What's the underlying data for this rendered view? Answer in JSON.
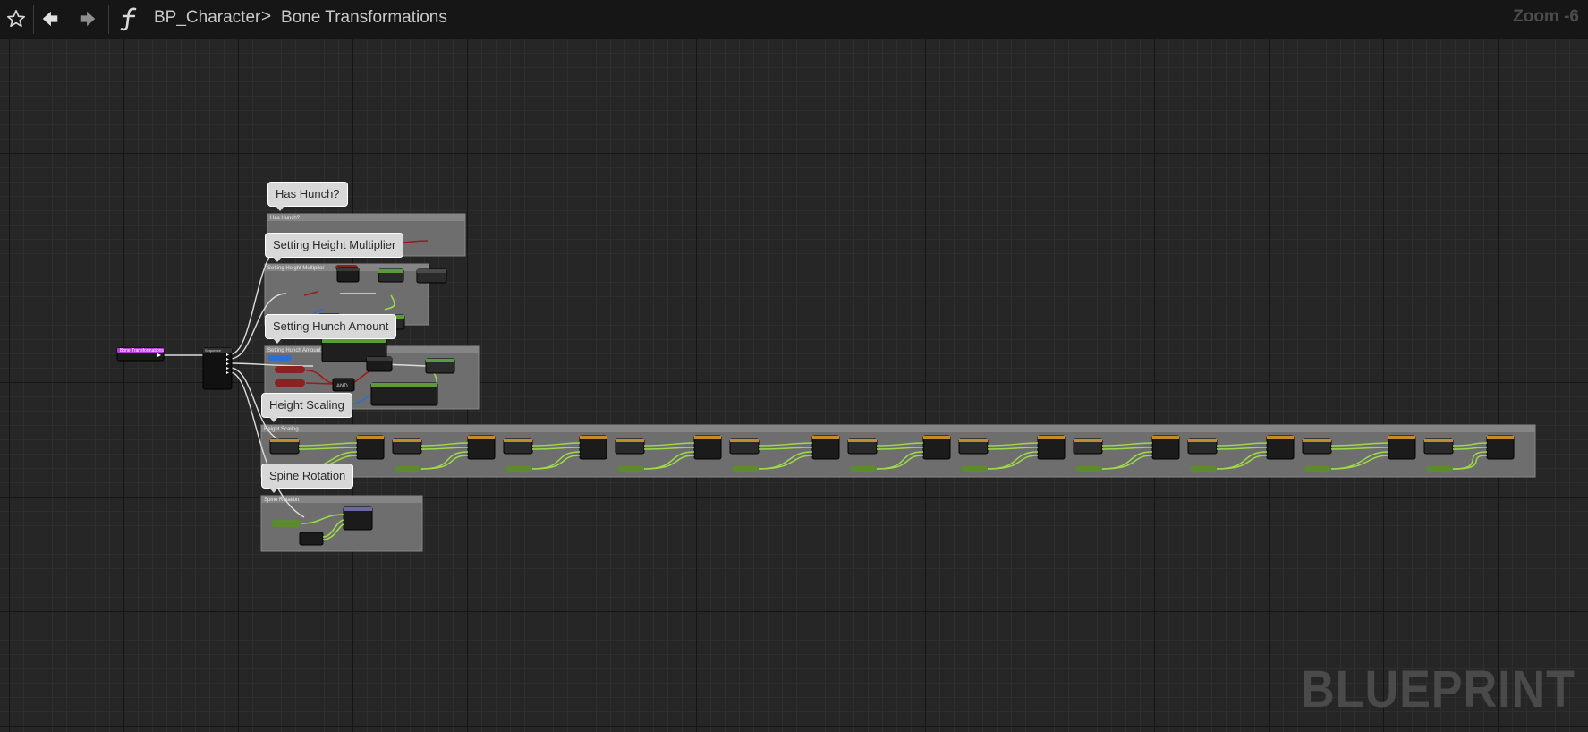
{
  "toolbar": {
    "favorite_icon": "star-outline-icon",
    "back_icon": "arrow-left-icon",
    "forward_icon": "arrow-right-icon",
    "function_icon": "function-f-icon",
    "breadcrumb": [
      "BP_Character",
      "Bone Transformations"
    ],
    "breadcrumb_separator": ">",
    "zoom_label": "Zoom -6"
  },
  "graph": {
    "watermark": "BLUEPRINT",
    "comment_bubbles": [
      "Has Hunch?",
      "Setting Height Multiplier",
      "Setting Hunch Amount",
      "Height Scaling",
      "Spine Rotation"
    ],
    "comment_titles": [
      "Has Hunch?",
      "Setting Height Multiplier",
      "Setting Hunch Amount",
      "Height Scaling",
      "Spine Rotation"
    ],
    "entry_node": "Bone Transformations",
    "sequence_node": "Sequence",
    "and_label": "AND",
    "colors": {
      "background": "#262626",
      "comment_box": "#6e6e6e",
      "exec_wire": "#d9d9d9",
      "bool_wire": "#9a1b1b",
      "float_wire": "#9ed94a",
      "object_wire": "#2a6fd6",
      "entry_header": "#b43bd6"
    }
  }
}
